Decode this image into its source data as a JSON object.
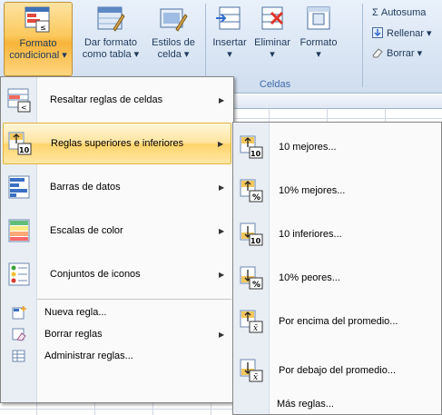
{
  "ribbon": {
    "buttons": [
      {
        "line1": "Formato",
        "line2": "condicional ▾",
        "icon": "conditional-format-icon"
      },
      {
        "line1": "Dar formato",
        "line2": "como tabla ▾",
        "icon": "format-as-table-icon"
      },
      {
        "line1": "Estilos de",
        "line2": "celda ▾",
        "icon": "cell-styles-icon"
      },
      {
        "line1": "Insertar",
        "line2": "▾",
        "icon": "insert-cells-icon"
      },
      {
        "line1": "Eliminar",
        "line2": "▾",
        "icon": "delete-cells-icon"
      },
      {
        "line1": "Formato",
        "line2": "▾",
        "icon": "format-cells-icon"
      }
    ],
    "group_celdas": "Celdas",
    "small": {
      "autosum": "Σ Autosuma",
      "fill": "Rellenar ▾",
      "clear": "Borrar ▾"
    }
  },
  "menu": {
    "items": [
      {
        "label": "Resaltar reglas de celdas",
        "icon": "highlight-rules-icon",
        "arrow": "▶"
      },
      {
        "label": "Reglas superiores e inferiores",
        "icon": "top-bottom-rules-icon",
        "arrow": "▶"
      },
      {
        "label": "Barras de datos",
        "icon": "data-bars-icon",
        "arrow": "▶"
      },
      {
        "label": "Escalas de color",
        "icon": "color-scales-icon",
        "arrow": "▶"
      },
      {
        "label": "Conjuntos de iconos",
        "icon": "icon-sets-icon",
        "arrow": "▶"
      }
    ],
    "small_items": [
      {
        "label": "Nueva regla...",
        "icon": "new-rule-icon"
      },
      {
        "label": "Borrar reglas",
        "icon": "clear-rules-icon",
        "arrow": "▶"
      },
      {
        "label": "Administrar reglas...",
        "icon": "manage-rules-icon"
      }
    ]
  },
  "submenu": {
    "items": [
      {
        "label": "10 mejores...",
        "icon": "top-10-icon"
      },
      {
        "label": "10% mejores...",
        "icon": "top-10-percent-icon"
      },
      {
        "label": "10 inferiores...",
        "icon": "bottom-10-icon"
      },
      {
        "label": "10% peores...",
        "icon": "bottom-10-percent-icon"
      },
      {
        "label": "Por encima del promedio...",
        "icon": "above-average-icon"
      },
      {
        "label": "Por debajo del promedio...",
        "icon": "below-average-icon"
      }
    ],
    "more": "Más reglas..."
  },
  "colors": {
    "highlight": "#ffd46a",
    "ribbon_bg": "#dbe6f4",
    "text_blue": "#1e395b"
  }
}
